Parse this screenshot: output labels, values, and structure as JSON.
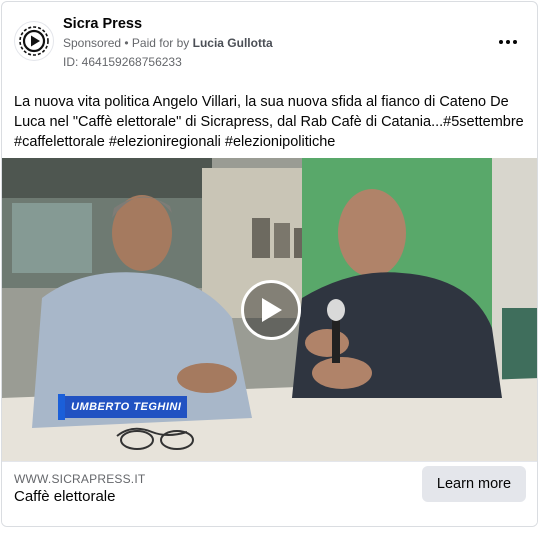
{
  "advertiser": {
    "name": "Sicra Press",
    "sponsored_label": "Sponsored",
    "separator": " • ",
    "paid_for_prefix": "Paid for by ",
    "payer": "Lucia Gullotta",
    "ad_id": "ID: 464159268756233"
  },
  "post": {
    "text": "La nuova vita politica Angelo Villari, la sua nuova sfida al fianco di Cateno De Luca nel \"Caffè elettorale\" di Sicrapress, dal Rab Cafè di Catania...#5settembre #caffelettorale #elezioniregionali #elezionipolitiche"
  },
  "video": {
    "lower_third": "UMBERTO TEGHINI",
    "play_icon": "play-icon"
  },
  "link": {
    "domain": "WWW.SICRAPRESS.IT",
    "headline": "Caffè elettorale",
    "cta_label": "Learn more"
  },
  "colors": {
    "lower_third_blue": "#2152c2",
    "green_wall": "#59a86a"
  }
}
